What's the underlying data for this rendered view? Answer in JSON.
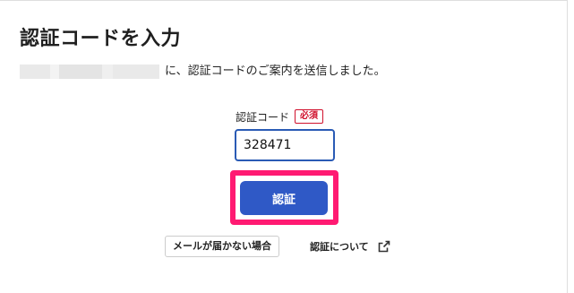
{
  "page": {
    "title": "認証コードを入力",
    "description": "に、認証コードのご案内を送信しました。"
  },
  "form": {
    "field_label": "認証コード",
    "required_badge": "必須",
    "code_value": "328471",
    "submit_label": "認証"
  },
  "links": {
    "no_mail_label": "メールが届かない場合",
    "about_label": "認証について"
  },
  "icons": {
    "external_link": "external-link-icon"
  },
  "colors": {
    "primary_button": "#2f59c6",
    "input_border": "#2a5bb5",
    "required": "#d0102c",
    "highlight": "#ff1a72"
  }
}
